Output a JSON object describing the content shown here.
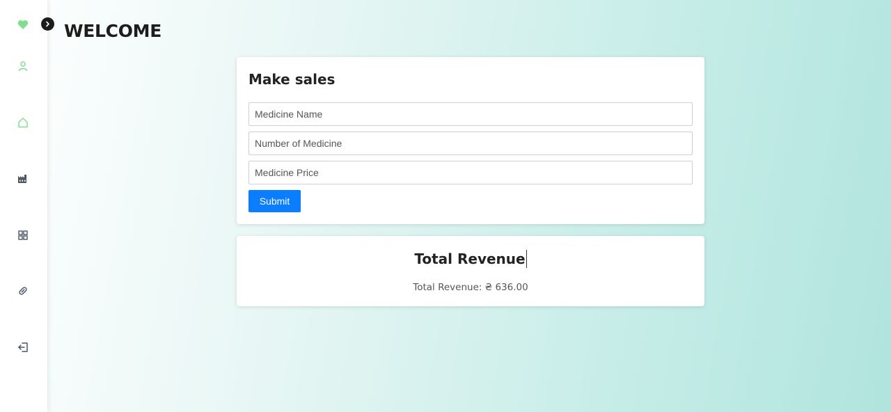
{
  "page": {
    "title": "WELCOME"
  },
  "sidebar": {
    "items": [
      {
        "name": "logo",
        "icon": "heart-icon",
        "color": "#7ee08f"
      },
      {
        "name": "profile",
        "icon": "user-icon",
        "color": "#7ee08f"
      },
      {
        "name": "home",
        "icon": "home-icon",
        "color": "#7ee08f"
      },
      {
        "name": "inventory",
        "icon": "factory-icon",
        "color": "#4b5563"
      },
      {
        "name": "dashboard",
        "icon": "grid-icon",
        "color": "#4b5563"
      },
      {
        "name": "medicine",
        "icon": "pill-icon",
        "color": "#4b5563"
      },
      {
        "name": "logout",
        "icon": "logout-icon",
        "color": "#4b5563"
      }
    ],
    "toggle_icon": "chevron-right-icon"
  },
  "sales_form": {
    "title": "Make sales",
    "medicine_name_placeholder": "Medicine Name",
    "number_placeholder": "Number of Medicine",
    "price_placeholder": "Medicine Price",
    "submit_label": "Submit",
    "accent": "#0b7dff"
  },
  "revenue": {
    "title": "Total Revenue",
    "value_text": "Total Revenue: ₴ 636.00"
  }
}
